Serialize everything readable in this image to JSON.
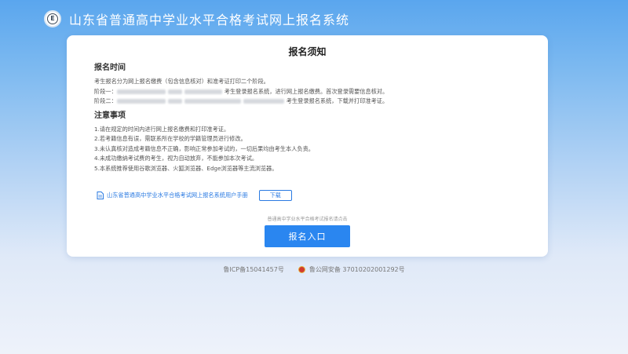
{
  "header": {
    "logo_letter": "E",
    "title": "山东省普通高中学业水平合格考试网上报名系统"
  },
  "card": {
    "title": "报名须知",
    "sections": [
      {
        "heading": "报名时间",
        "lines": [
          {
            "text": "考生报名分为网上报名缴费（包含信息核对）和准考证打印二个阶段。"
          },
          {
            "text": "阶段一：",
            "tail": "考生登录报名系统，进行网上报名缴费。首次登录需要信息核对。"
          },
          {
            "text": "阶段二：",
            "tail": "考生登录报名系统，下载并打印准考证。"
          }
        ]
      },
      {
        "heading": "注意事项",
        "lines": [
          {
            "text": "1.请在规定的时间内进行网上报名缴费和打印准考证。"
          },
          {
            "text": "2.若考籍信息有误，需联系所在学校的学籍管理员进行修改。"
          },
          {
            "text": "3.未认真核对造成考籍信息不正确，影响正常参加考试的，一切后果均由考生本人负责。"
          },
          {
            "text": "4.未成功缴纳考试费的考生，视为自动放弃，不能参加本次考试。"
          },
          {
            "text": "5.本系统推荐使用谷歌浏览器、火狐浏览器、Edge浏览器等主流浏览器。"
          }
        ]
      }
    ],
    "manual_link": "山东省普通高中学业水平合格考试网上报名系统用户手册",
    "download_label": "下载",
    "hint": "普通高中学业水平合格考试报名请点击",
    "enter_label": "报名入口"
  },
  "footer": {
    "icp": "鲁ICP备15041457号",
    "police": "鲁公网安备 37010202001292号"
  }
}
